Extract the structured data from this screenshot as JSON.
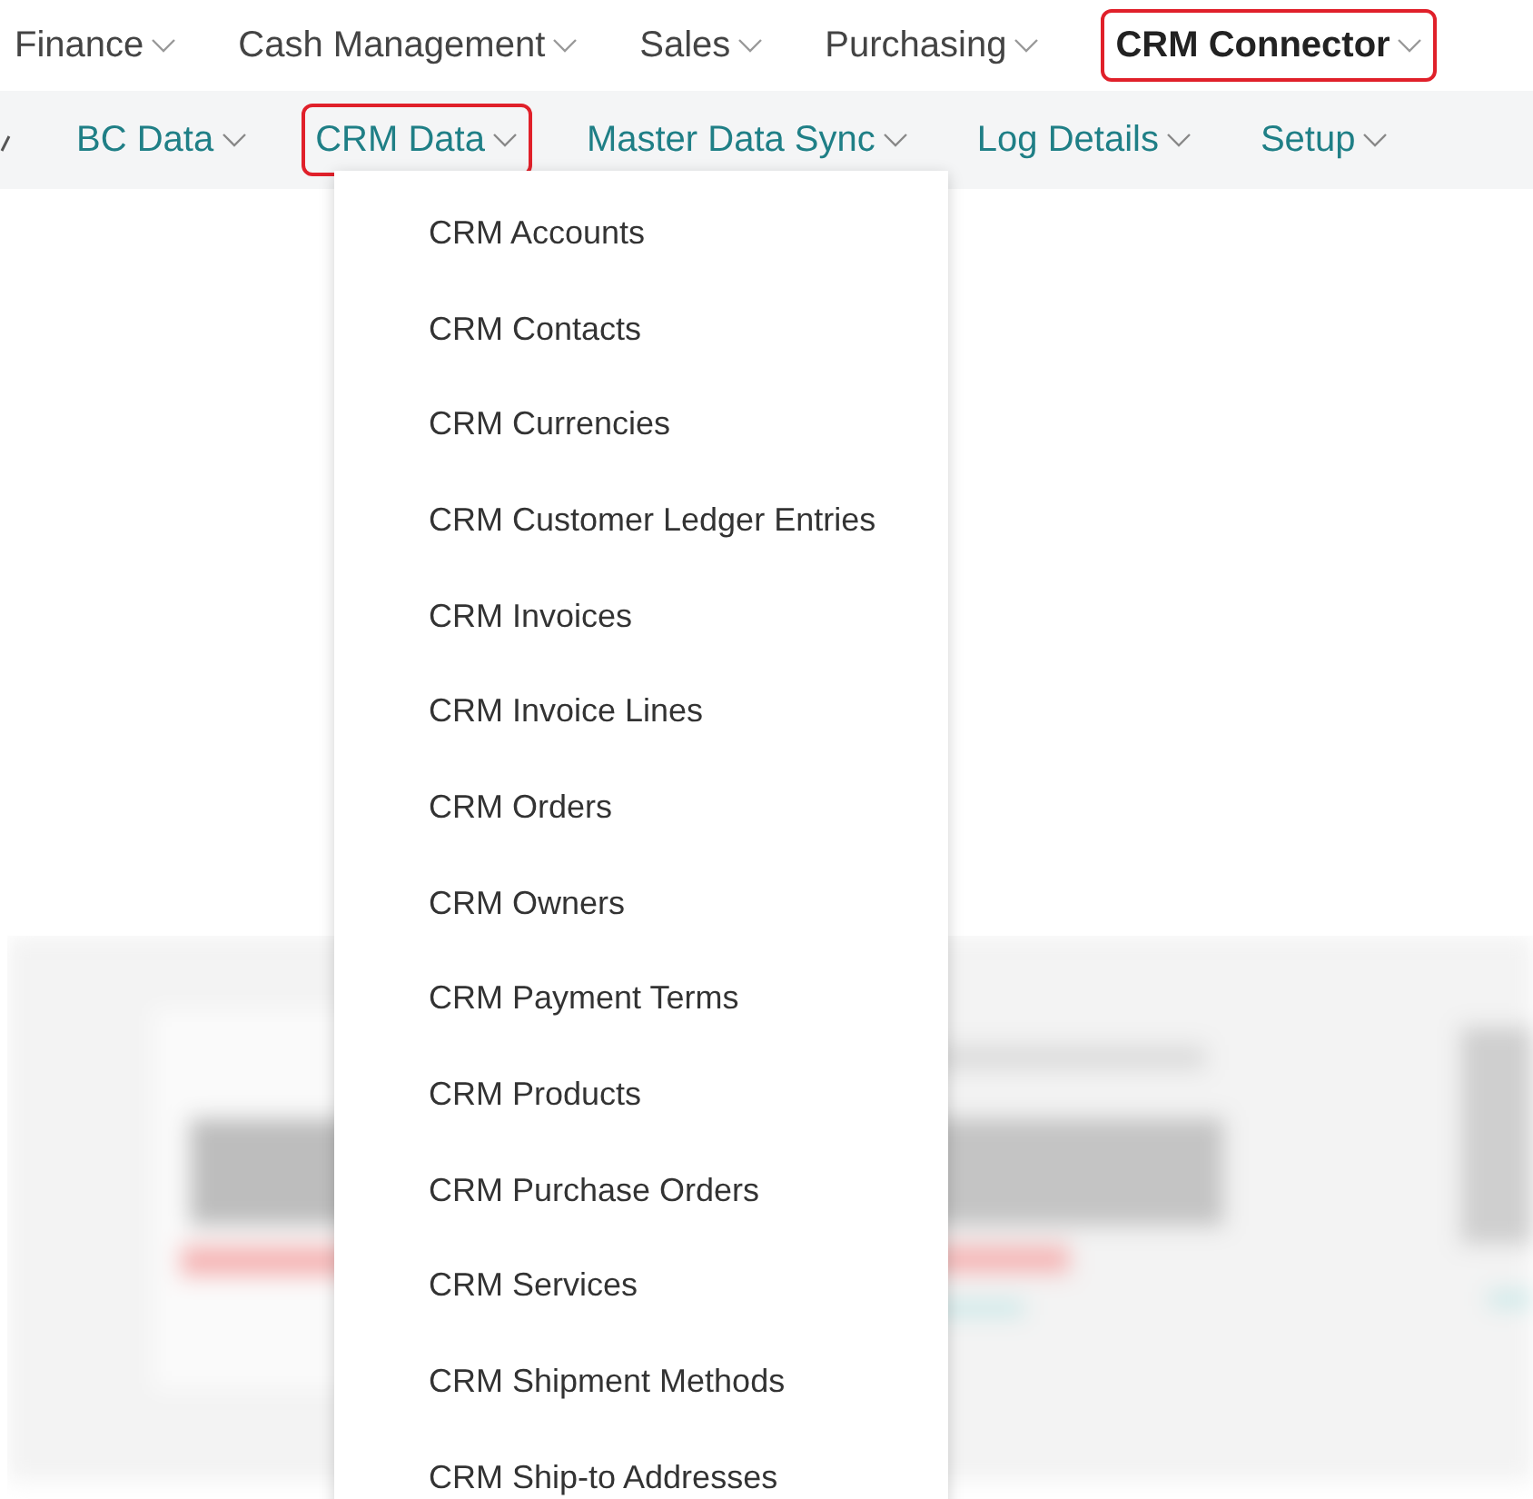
{
  "top_nav": [
    {
      "label": "Finance",
      "selected": false,
      "highlighted": false
    },
    {
      "label": "Cash Management",
      "selected": false,
      "highlighted": false
    },
    {
      "label": "Sales",
      "selected": false,
      "highlighted": false
    },
    {
      "label": "Purchasing",
      "selected": false,
      "highlighted": false
    },
    {
      "label": "CRM Connector",
      "selected": true,
      "highlighted": true
    }
  ],
  "sub_nav": [
    {
      "label": "BC Data",
      "highlighted": false
    },
    {
      "label": "CRM Data",
      "highlighted": true
    },
    {
      "label": "Master Data Sync",
      "highlighted": false
    },
    {
      "label": "Log Details",
      "highlighted": false
    },
    {
      "label": "Setup",
      "highlighted": false
    }
  ],
  "dropdown_items": [
    "CRM Accounts",
    "CRM Contacts",
    "CRM Currencies",
    "CRM Customer Ledger Entries",
    "CRM Invoices",
    "CRM Invoice Lines",
    "CRM Orders",
    "CRM Owners",
    "CRM Payment Terms",
    "CRM Products",
    "CRM Purchase Orders",
    "CRM Services",
    "CRM Shipment Methods",
    "CRM Ship-to Addresses"
  ]
}
